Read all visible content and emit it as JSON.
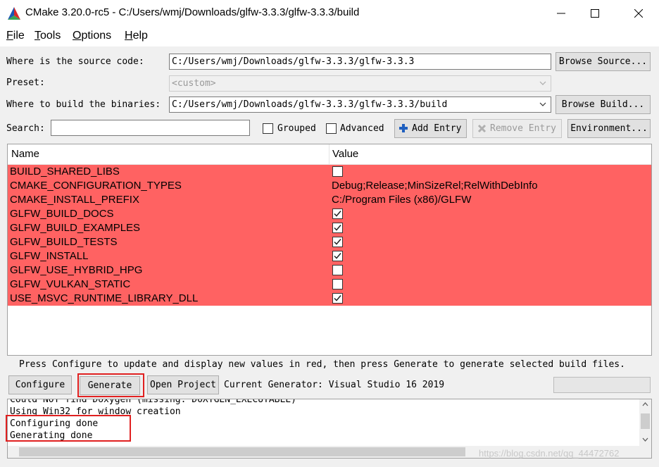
{
  "window": {
    "title": "CMake 3.20.0-rc5 - C:/Users/wmj/Downloads/glfw-3.3.3/glfw-3.3.3/build"
  },
  "menu": {
    "items": [
      {
        "first": "F",
        "rest": "ile"
      },
      {
        "first": "T",
        "rest": "ools"
      },
      {
        "first": "O",
        "rest": "ptions"
      },
      {
        "first": "H",
        "rest": "elp"
      }
    ]
  },
  "source": {
    "label": "Where is the source code:",
    "value": "C:/Users/wmj/Downloads/glfw-3.3.3/glfw-3.3.3",
    "browse_label": "Browse Source..."
  },
  "preset": {
    "label": "Preset:",
    "value": "<custom>"
  },
  "binaries": {
    "label": "Where to build the binaries:",
    "value": "C:/Users/wmj/Downloads/glfw-3.3.3/glfw-3.3.3/build",
    "browse_label": "Browse Build..."
  },
  "search": {
    "label": "Search:",
    "value": "",
    "grouped_label": "Grouped",
    "grouped_checked": false,
    "advanced_label": "Advanced",
    "advanced_checked": false,
    "add_entry_label": "Add Entry",
    "remove_entry_label": "Remove Entry",
    "environment_label": "Environment..."
  },
  "table": {
    "headers": {
      "name": "Name",
      "value": "Value"
    },
    "row_color": "#ff6262",
    "rows": [
      {
        "name": "BUILD_SHARED_LIBS",
        "type": "bool",
        "checked": false
      },
      {
        "name": "CMAKE_CONFIGURATION_TYPES",
        "type": "text",
        "value": "Debug;Release;MinSizeRel;RelWithDebInfo"
      },
      {
        "name": "CMAKE_INSTALL_PREFIX",
        "type": "text",
        "value": "C:/Program Files (x86)/GLFW"
      },
      {
        "name": "GLFW_BUILD_DOCS",
        "type": "bool",
        "checked": true
      },
      {
        "name": "GLFW_BUILD_EXAMPLES",
        "type": "bool",
        "checked": true
      },
      {
        "name": "GLFW_BUILD_TESTS",
        "type": "bool",
        "checked": true
      },
      {
        "name": "GLFW_INSTALL",
        "type": "bool",
        "checked": true
      },
      {
        "name": "GLFW_USE_HYBRID_HPG",
        "type": "bool",
        "checked": false
      },
      {
        "name": "GLFW_VULKAN_STATIC",
        "type": "bool",
        "checked": false
      },
      {
        "name": "USE_MSVC_RUNTIME_LIBRARY_DLL",
        "type": "bool",
        "checked": true
      }
    ]
  },
  "hint": "Press Configure to update and display new values in red, then press Generate to generate selected build files.",
  "actions": {
    "configure_label": "Configure",
    "generate_label": "Generate",
    "open_project_label": "Open Project",
    "generator_text": "Current Generator: Visual Studio 16 2019"
  },
  "output": {
    "lines": [
      "Could NOT find Doxygen (missing: DOXYGEN_EXECUTABLE)",
      "Using Win32 for window creation",
      "Configuring done",
      "Generating done"
    ]
  },
  "watermark": "https://blog.csdn.net/qq_44472762",
  "colors": {
    "highlight_box": "#e02020",
    "accent": "#1f5fbf"
  }
}
